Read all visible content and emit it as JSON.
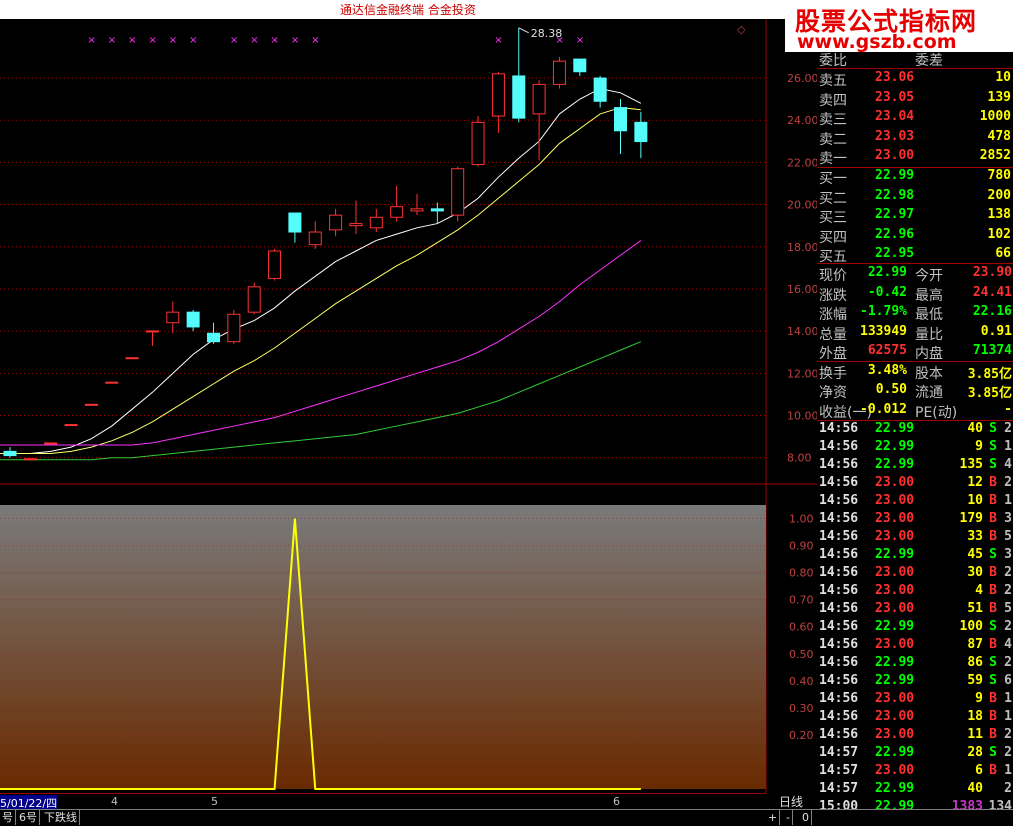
{
  "window": {
    "title": "通达信金融终端    合金投资"
  },
  "watermark": {
    "line1": "股票公式指标网",
    "line2": "www.gszb.com"
  },
  "chart_data": [
    {
      "type": "candlestick",
      "name": "",
      "y_ticks": [
        "26.00",
        "24.00",
        "22.00",
        "20.00",
        "18.00",
        "16.00",
        "14.00",
        "12.00",
        "10.00",
        "8.00"
      ],
      "ylim": [
        6.8,
        28.8
      ],
      "high_label": "28.38",
      "candles": [
        {
          "o": 8.3,
          "h": 8.5,
          "l": 8.0,
          "c": 8.1
        },
        {
          "o": 7.9,
          "h": 8.0,
          "l": 7.9,
          "c": 7.95
        },
        {
          "o": 8.7,
          "h": 8.7,
          "l": 8.7,
          "c": 8.7
        },
        {
          "o": 9.57,
          "h": 9.57,
          "l": 9.57,
          "c": 9.57
        },
        {
          "o": 10.53,
          "h": 10.53,
          "l": 10.53,
          "c": 10.53
        },
        {
          "o": 11.58,
          "h": 11.58,
          "l": 11.58,
          "c": 11.58
        },
        {
          "o": 12.74,
          "h": 12.74,
          "l": 12.74,
          "c": 12.74
        },
        {
          "o": 14.01,
          "h": 14.01,
          "l": 13.3,
          "c": 14.01
        },
        {
          "o": 14.4,
          "h": 15.4,
          "l": 13.9,
          "c": 14.9
        },
        {
          "o": 14.9,
          "h": 15.0,
          "l": 14.0,
          "c": 14.2
        },
        {
          "o": 13.9,
          "h": 14.4,
          "l": 13.4,
          "c": 13.5
        },
        {
          "o": 13.5,
          "h": 15.0,
          "l": 13.4,
          "c": 14.8
        },
        {
          "o": 14.9,
          "h": 16.3,
          "l": 14.8,
          "c": 16.1
        },
        {
          "o": 16.5,
          "h": 17.9,
          "l": 16.4,
          "c": 17.8
        },
        {
          "o": 19.6,
          "h": 19.6,
          "l": 18.2,
          "c": 18.7
        },
        {
          "o": 18.1,
          "h": 19.2,
          "l": 17.9,
          "c": 18.7
        },
        {
          "o": 18.8,
          "h": 19.8,
          "l": 18.5,
          "c": 19.5
        },
        {
          "o": 19.0,
          "h": 20.2,
          "l": 18.6,
          "c": 19.1
        },
        {
          "o": 18.9,
          "h": 19.8,
          "l": 18.7,
          "c": 19.4
        },
        {
          "o": 19.4,
          "h": 20.9,
          "l": 19.2,
          "c": 19.9
        },
        {
          "o": 19.7,
          "h": 20.5,
          "l": 19.5,
          "c": 19.8
        },
        {
          "o": 19.8,
          "h": 20.1,
          "l": 19.1,
          "c": 19.7
        },
        {
          "o": 19.5,
          "h": 21.8,
          "l": 19.2,
          "c": 21.7
        },
        {
          "o": 21.9,
          "h": 24.2,
          "l": 21.8,
          "c": 23.9
        },
        {
          "o": 24.2,
          "h": 26.3,
          "l": 23.4,
          "c": 26.2
        },
        {
          "o": 26.1,
          "h": 28.38,
          "l": 23.9,
          "c": 24.1
        },
        {
          "o": 24.3,
          "h": 25.9,
          "l": 22.1,
          "c": 25.7
        },
        {
          "o": 25.7,
          "h": 27.0,
          "l": 25.5,
          "c": 26.8
        },
        {
          "o": 26.9,
          "h": 26.9,
          "l": 26.1,
          "c": 26.3
        },
        {
          "o": 26.0,
          "h": 26.1,
          "l": 24.6,
          "c": 24.9
        },
        {
          "o": 24.6,
          "h": 25.0,
          "l": 22.4,
          "c": 23.5
        },
        {
          "o": 23.9,
          "h": 24.4,
          "l": 22.2,
          "c": 22.99
        }
      ],
      "signal_marks": [
        4,
        5,
        6,
        7,
        8,
        9,
        11,
        12,
        13,
        14,
        15,
        24,
        27,
        28
      ],
      "ma_lines": [
        {
          "color": "#ffffff",
          "values": [
            8.2,
            8.2,
            8.3,
            8.5,
            8.9,
            9.5,
            10.3,
            11.1,
            12.0,
            12.9,
            13.6,
            14.1,
            14.5,
            15.1,
            15.9,
            16.6,
            17.3,
            17.8,
            18.3,
            18.6,
            18.9,
            19.1,
            19.6,
            20.3,
            21.3,
            22.2,
            23.0,
            24.3,
            25.0,
            25.5,
            25.3,
            24.8
          ]
        },
        {
          "color": "#ffff66",
          "values": [
            8.2,
            8.2,
            8.2,
            8.3,
            8.5,
            8.8,
            9.2,
            9.7,
            10.3,
            10.9,
            11.5,
            12.1,
            12.6,
            13.2,
            13.9,
            14.6,
            15.3,
            15.9,
            16.5,
            17.1,
            17.6,
            18.2,
            18.8,
            19.5,
            20.3,
            21.1,
            21.9,
            22.9,
            23.6,
            24.3,
            24.6,
            24.5
          ]
        },
        {
          "color": "#ff33ff",
          "values": [
            8.6,
            8.6,
            8.6,
            8.6,
            8.6,
            8.6,
            8.6,
            8.7,
            8.9,
            9.1,
            9.3,
            9.5,
            9.7,
            9.9,
            10.2,
            10.5,
            10.8,
            11.1,
            11.4,
            11.7,
            12.0,
            12.3,
            12.6,
            13.0,
            13.5,
            14.1,
            14.7,
            15.4,
            16.2,
            16.9,
            17.6,
            18.3
          ]
        },
        {
          "color": "#33cc33",
          "values": [
            7.9,
            7.9,
            7.9,
            7.9,
            7.9,
            8.0,
            8.0,
            8.1,
            8.2,
            8.3,
            8.4,
            8.5,
            8.6,
            8.7,
            8.8,
            8.9,
            9.0,
            9.1,
            9.3,
            9.5,
            9.7,
            9.9,
            10.1,
            10.4,
            10.7,
            11.1,
            11.5,
            11.9,
            12.3,
            12.7,
            13.1,
            13.5
          ]
        }
      ]
    },
    {
      "type": "line",
      "name": "",
      "y_ticks": [
        "1.00",
        "0.90",
        "0.80",
        "0.70",
        "0.60",
        "0.50",
        "0.40",
        "0.30",
        "0.20"
      ],
      "ylim": [
        0,
        1.05
      ],
      "x": [
        0,
        1,
        2,
        3,
        4,
        5,
        6,
        7,
        8,
        9,
        10,
        11,
        12,
        13,
        14,
        15,
        16,
        17,
        18,
        19,
        20,
        21,
        22,
        23,
        24,
        25,
        26,
        27,
        28,
        29,
        30,
        31
      ],
      "values": [
        0,
        0,
        0,
        0,
        0,
        0,
        0,
        0,
        0,
        0,
        0,
        0,
        0,
        0,
        1,
        0,
        0,
        0,
        0,
        0,
        0,
        0,
        0,
        0,
        0,
        0,
        0,
        0,
        0,
        0,
        0,
        0
      ]
    }
  ],
  "date_axis": {
    "first_date": "5/01/22/四",
    "month_labels": [
      "4",
      "5",
      "6"
    ],
    "period": "日线"
  },
  "bottom_tabs": [
    "号",
    "6号",
    "下跌线"
  ],
  "bottom_controls": [
    "+",
    "-",
    "0"
  ],
  "quote": {
    "header_partial": [
      "委比",
      "委差"
    ],
    "asks": [
      {
        "label": "卖五",
        "price": "23.06",
        "vol": "10"
      },
      {
        "label": "卖四",
        "price": "23.05",
        "vol": "139"
      },
      {
        "label": "卖三",
        "price": "23.04",
        "vol": "1000"
      },
      {
        "label": "卖二",
        "price": "23.03",
        "vol": "478"
      },
      {
        "label": "卖一",
        "price": "23.00",
        "vol": "2852"
      }
    ],
    "bids": [
      {
        "label": "买一",
        "price": "22.99",
        "vol": "780"
      },
      {
        "label": "买二",
        "price": "22.98",
        "vol": "200"
      },
      {
        "label": "买三",
        "price": "22.97",
        "vol": "138"
      },
      {
        "label": "买四",
        "price": "22.96",
        "vol": "102"
      },
      {
        "label": "买五",
        "price": "22.95",
        "vol": "66"
      }
    ],
    "stats": [
      {
        "l1": "现价",
        "v1": "22.99",
        "c1": "#00ff00",
        "l2": "今开",
        "v2": "23.90",
        "c2": "#ff3030"
      },
      {
        "l1": "涨跌",
        "v1": "-0.42",
        "c1": "#00ff00",
        "l2": "最高",
        "v2": "24.41",
        "c2": "#ff3030"
      },
      {
        "l1": "涨幅",
        "v1": "-1.79%",
        "c1": "#00ff00",
        "l2": "最低",
        "v2": "22.16",
        "c2": "#00ff00"
      },
      {
        "l1": "总量",
        "v1": "133949",
        "c1": "#ffff00",
        "l2": "量比",
        "v2": "0.91",
        "c2": "#ffff00"
      },
      {
        "l1": "外盘",
        "v1": "62575",
        "c1": "#ff3030",
        "l2": "内盘",
        "v2": "71374",
        "c2": "#00ff00"
      },
      {
        "l1": "换手",
        "v1": "3.48%",
        "c1": "#ffff00",
        "l2": "股本",
        "v2": "3.85亿",
        "c2": "#ffff00"
      },
      {
        "l1": "净资",
        "v1": "0.50",
        "c1": "#ffff00",
        "l2": "流通",
        "v2": "3.85亿",
        "c2": "#ffff00"
      },
      {
        "l1": "收益(一)",
        "v1": "-0.012",
        "c1": "#ffff00",
        "l2": "PE(动)",
        "v2": "-",
        "c2": "#ffff00"
      }
    ],
    "colors": {
      "up": "#ff3030",
      "down": "#00ff00",
      "neutral": "#ffff00"
    }
  },
  "ticks": [
    {
      "t": "14:56",
      "p": "22.99",
      "v": "40",
      "bs": "S",
      "n": "2"
    },
    {
      "t": "14:56",
      "p": "22.99",
      "v": "9",
      "bs": "S",
      "n": "1"
    },
    {
      "t": "14:56",
      "p": "22.99",
      "v": "135",
      "bs": "S",
      "n": "4"
    },
    {
      "t": "14:56",
      "p": "23.00",
      "v": "12",
      "bs": "B",
      "n": "2"
    },
    {
      "t": "14:56",
      "p": "23.00",
      "v": "10",
      "bs": "B",
      "n": "1"
    },
    {
      "t": "14:56",
      "p": "23.00",
      "v": "179",
      "bs": "B",
      "n": "3"
    },
    {
      "t": "14:56",
      "p": "23.00",
      "v": "33",
      "bs": "B",
      "n": "5"
    },
    {
      "t": "14:56",
      "p": "22.99",
      "v": "45",
      "bs": "S",
      "n": "3"
    },
    {
      "t": "14:56",
      "p": "23.00",
      "v": "30",
      "bs": "B",
      "n": "2"
    },
    {
      "t": "14:56",
      "p": "23.00",
      "v": "4",
      "bs": "B",
      "n": "2"
    },
    {
      "t": "14:56",
      "p": "23.00",
      "v": "51",
      "bs": "B",
      "n": "5"
    },
    {
      "t": "14:56",
      "p": "22.99",
      "v": "100",
      "bs": "S",
      "n": "2"
    },
    {
      "t": "14:56",
      "p": "23.00",
      "v": "87",
      "bs": "B",
      "n": "4"
    },
    {
      "t": "14:56",
      "p": "22.99",
      "v": "86",
      "bs": "S",
      "n": "2"
    },
    {
      "t": "14:56",
      "p": "22.99",
      "v": "59",
      "bs": "S",
      "n": "6"
    },
    {
      "t": "14:56",
      "p": "23.00",
      "v": "9",
      "bs": "B",
      "n": "1"
    },
    {
      "t": "14:56",
      "p": "23.00",
      "v": "18",
      "bs": "B",
      "n": "1"
    },
    {
      "t": "14:56",
      "p": "23.00",
      "v": "11",
      "bs": "B",
      "n": "2"
    },
    {
      "t": "14:57",
      "p": "22.99",
      "v": "28",
      "bs": "S",
      "n": "2"
    },
    {
      "t": "14:57",
      "p": "23.00",
      "v": "6",
      "bs": "B",
      "n": "1"
    },
    {
      "t": "14:57",
      "p": "22.99",
      "v": "40",
      "bs": "",
      "n": "2"
    },
    {
      "t": "15:00",
      "p": "22.99",
      "v": "1383",
      "bs": "",
      "n": "134"
    }
  ]
}
